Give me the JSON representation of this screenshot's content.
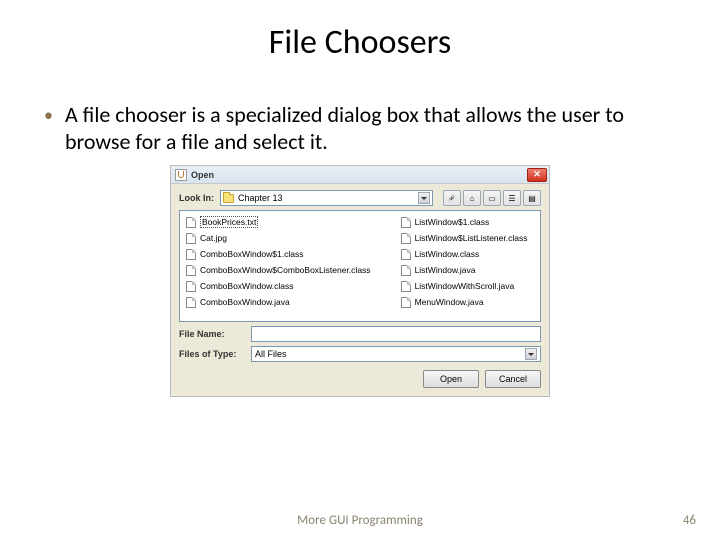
{
  "slide": {
    "title": "File Choosers",
    "bullet": "A file chooser is a specialized dialog box that allows the user to browse for a file and select it.",
    "footer": "More GUI Programming",
    "page": "46"
  },
  "dialog": {
    "title": "Open",
    "lookin_label": "Look In:",
    "lookin_value": "Chapter 13",
    "files_left": [
      "BookPrices.txt",
      "Cat.jpg",
      "ComboBoxWindow$1.class",
      "ComboBoxWindow$ComboBoxListener.class",
      "ComboBoxWindow.class",
      "ComboBoxWindow.java"
    ],
    "files_right": [
      "ListWindow$1.class",
      "ListWindow$ListListener.class",
      "ListWindow.class",
      "ListWindow.java",
      "ListWindowWithScroll.java",
      "MenuWindow.java"
    ],
    "filename_label": "File Name:",
    "filename_value": "",
    "filetype_label": "Files of Type:",
    "filetype_value": "All Files",
    "open_btn": "Open",
    "cancel_btn": "Cancel"
  }
}
